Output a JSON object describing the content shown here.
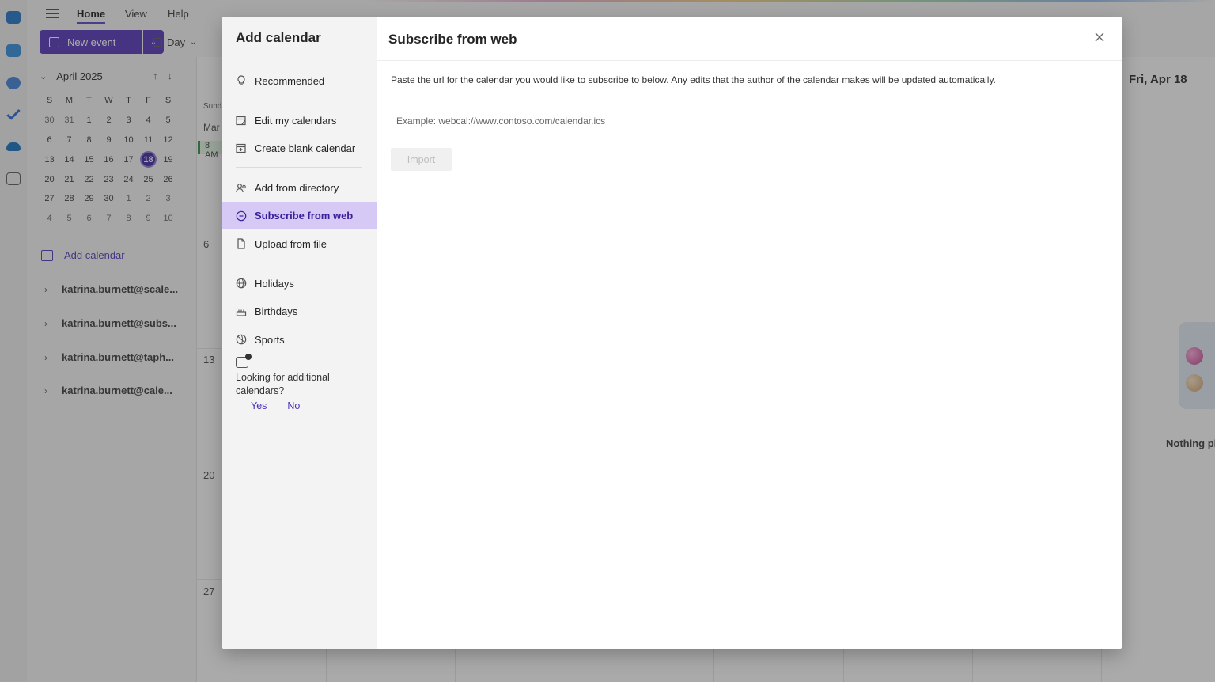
{
  "menubar": {
    "tabs": [
      "Home",
      "View",
      "Help"
    ],
    "active": "Home"
  },
  "toolbar": {
    "new_event_label": "New event",
    "view_label": "Day"
  },
  "minical": {
    "month_label": "April 2025",
    "weekdays": [
      "S",
      "M",
      "T",
      "W",
      "T",
      "F",
      "S"
    ],
    "weeks": [
      [
        "30",
        "31",
        "1",
        "2",
        "3",
        "4",
        "5"
      ],
      [
        "6",
        "7",
        "8",
        "9",
        "10",
        "11",
        "12"
      ],
      [
        "13",
        "14",
        "15",
        "16",
        "17",
        "18",
        "19"
      ],
      [
        "20",
        "21",
        "22",
        "23",
        "24",
        "25",
        "26"
      ],
      [
        "27",
        "28",
        "29",
        "30",
        "1",
        "2",
        "3"
      ],
      [
        "4",
        "5",
        "6",
        "7",
        "8",
        "9",
        "10"
      ]
    ],
    "today": "18"
  },
  "sidebar": {
    "add_calendar_label": "Add calendar",
    "accounts": [
      "katrina.burnett@scale...",
      "katrina.burnett@subs...",
      "katrina.burnett@taph...",
      "katrina.burnett@cale..."
    ]
  },
  "calendar": {
    "week_numbers": [
      "6",
      "13",
      "20",
      "27"
    ],
    "header_fragment": "Sunda",
    "month_fragment": "Mar",
    "event_fragment": "8 AM",
    "agenda_date": "Fri, Apr 18",
    "agenda_empty": "Nothing pl"
  },
  "dialog": {
    "title": "Add calendar",
    "nav": [
      {
        "label": "Recommended",
        "icon": "lightbulb-icon"
      },
      {
        "label": "Edit my calendars",
        "icon": "edit-calendar-icon"
      },
      {
        "label": "Create blank calendar",
        "icon": "add-calendar-icon"
      },
      {
        "label": "Add from directory",
        "icon": "people-icon"
      },
      {
        "label": "Subscribe from web",
        "icon": "link-icon"
      },
      {
        "label": "Upload from file",
        "icon": "document-icon"
      },
      {
        "label": "Holidays",
        "icon": "globe-icon"
      },
      {
        "label": "Birthdays",
        "icon": "cake-icon"
      },
      {
        "label": "Sports",
        "icon": "sports-ball-icon"
      }
    ],
    "active_nav": "Subscribe from web",
    "feedback": {
      "question": "Looking for additional calendars?",
      "yes": "Yes",
      "no": "No"
    },
    "panel": {
      "title": "Subscribe from web",
      "description": "Paste the url for the calendar you would like to subscribe to below. Any edits that the author of the calendar makes will be updated automatically.",
      "input_placeholder": "Example: webcal://www.contoso.com/calendar.ics",
      "input_value": "",
      "import_label": "Import"
    }
  },
  "colors": {
    "accent": "#4f2fb7",
    "active_nav_bg": "#d6c9f5",
    "today_bg": "#3b1f9a"
  }
}
